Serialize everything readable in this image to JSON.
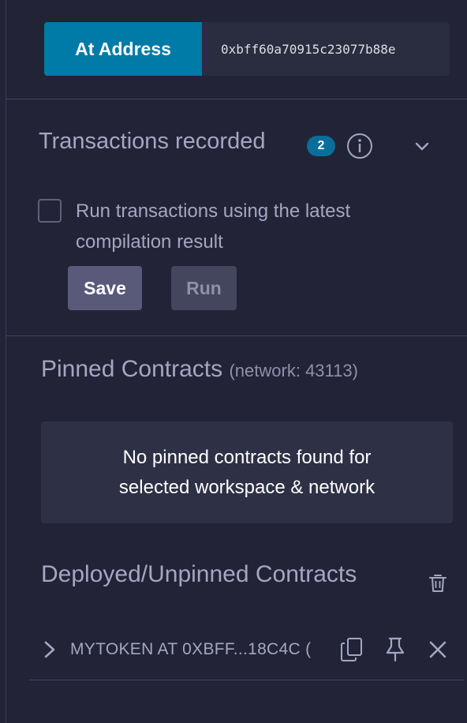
{
  "at_address": {
    "button_label": "At Address",
    "input_value": "0xbff60a70915c23077b88e"
  },
  "transactions": {
    "title": "Transactions recorded",
    "count": "2",
    "checkbox_label": "Run transactions using the latest compilation result",
    "checkbox_checked": false,
    "save_label": "Save",
    "run_label": "Run"
  },
  "pinned": {
    "title": "Pinned Contracts",
    "network": "(network: 43113)",
    "empty_message": "No pinned contracts found for selected workspace & network"
  },
  "deployed": {
    "title": "Deployed/Unpinned Contracts",
    "contracts": [
      {
        "label": "MYTOKEN AT 0XBFF...18C4C ("
      }
    ]
  },
  "colors": {
    "background": "#222336",
    "accent": "#007aa6",
    "badge": "#0a6e9a",
    "text_muted": "#a4a7c2"
  },
  "icons": {
    "info": "info-circle-icon",
    "chevron": "chevron-down-icon",
    "trash": "trash-icon",
    "expand": "chevron-right-icon",
    "copy": "copy-icon",
    "pin": "pin-icon",
    "close": "close-icon"
  }
}
